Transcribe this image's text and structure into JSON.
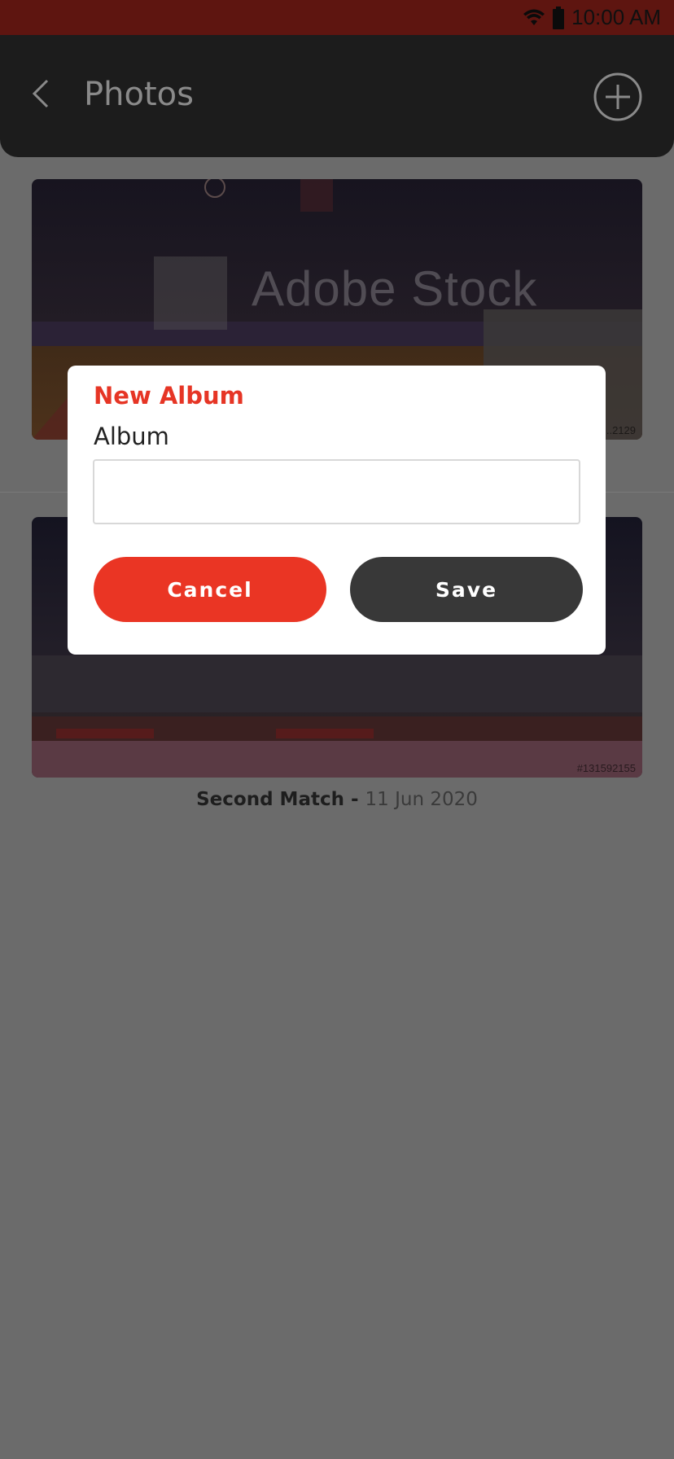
{
  "status_bar": {
    "time": "10:00 AM",
    "icons": [
      "wifi-icon",
      "battery-icon"
    ],
    "color": "#5e1510"
  },
  "header": {
    "title": "Photos",
    "back_icon": "chevron-left-icon",
    "add_icon": "plus-circle-icon",
    "background": "#1c1c1c"
  },
  "albums": [
    {
      "image_desc": "basketball arena stock photo",
      "watermark": "Adobe Stock",
      "stock_id": "#...2129"
    },
    {
      "title": "Second Match - ",
      "date": "11 Jun 2020",
      "image_desc": "basketball arena crowd stock photo",
      "stock_id": "#131592155"
    }
  ],
  "dialog": {
    "title": "New Album",
    "field_label": "Album",
    "input_value": "",
    "cancel_label": "Cancel",
    "save_label": "Save",
    "accent": "#ea3524",
    "dark": "#383838"
  }
}
